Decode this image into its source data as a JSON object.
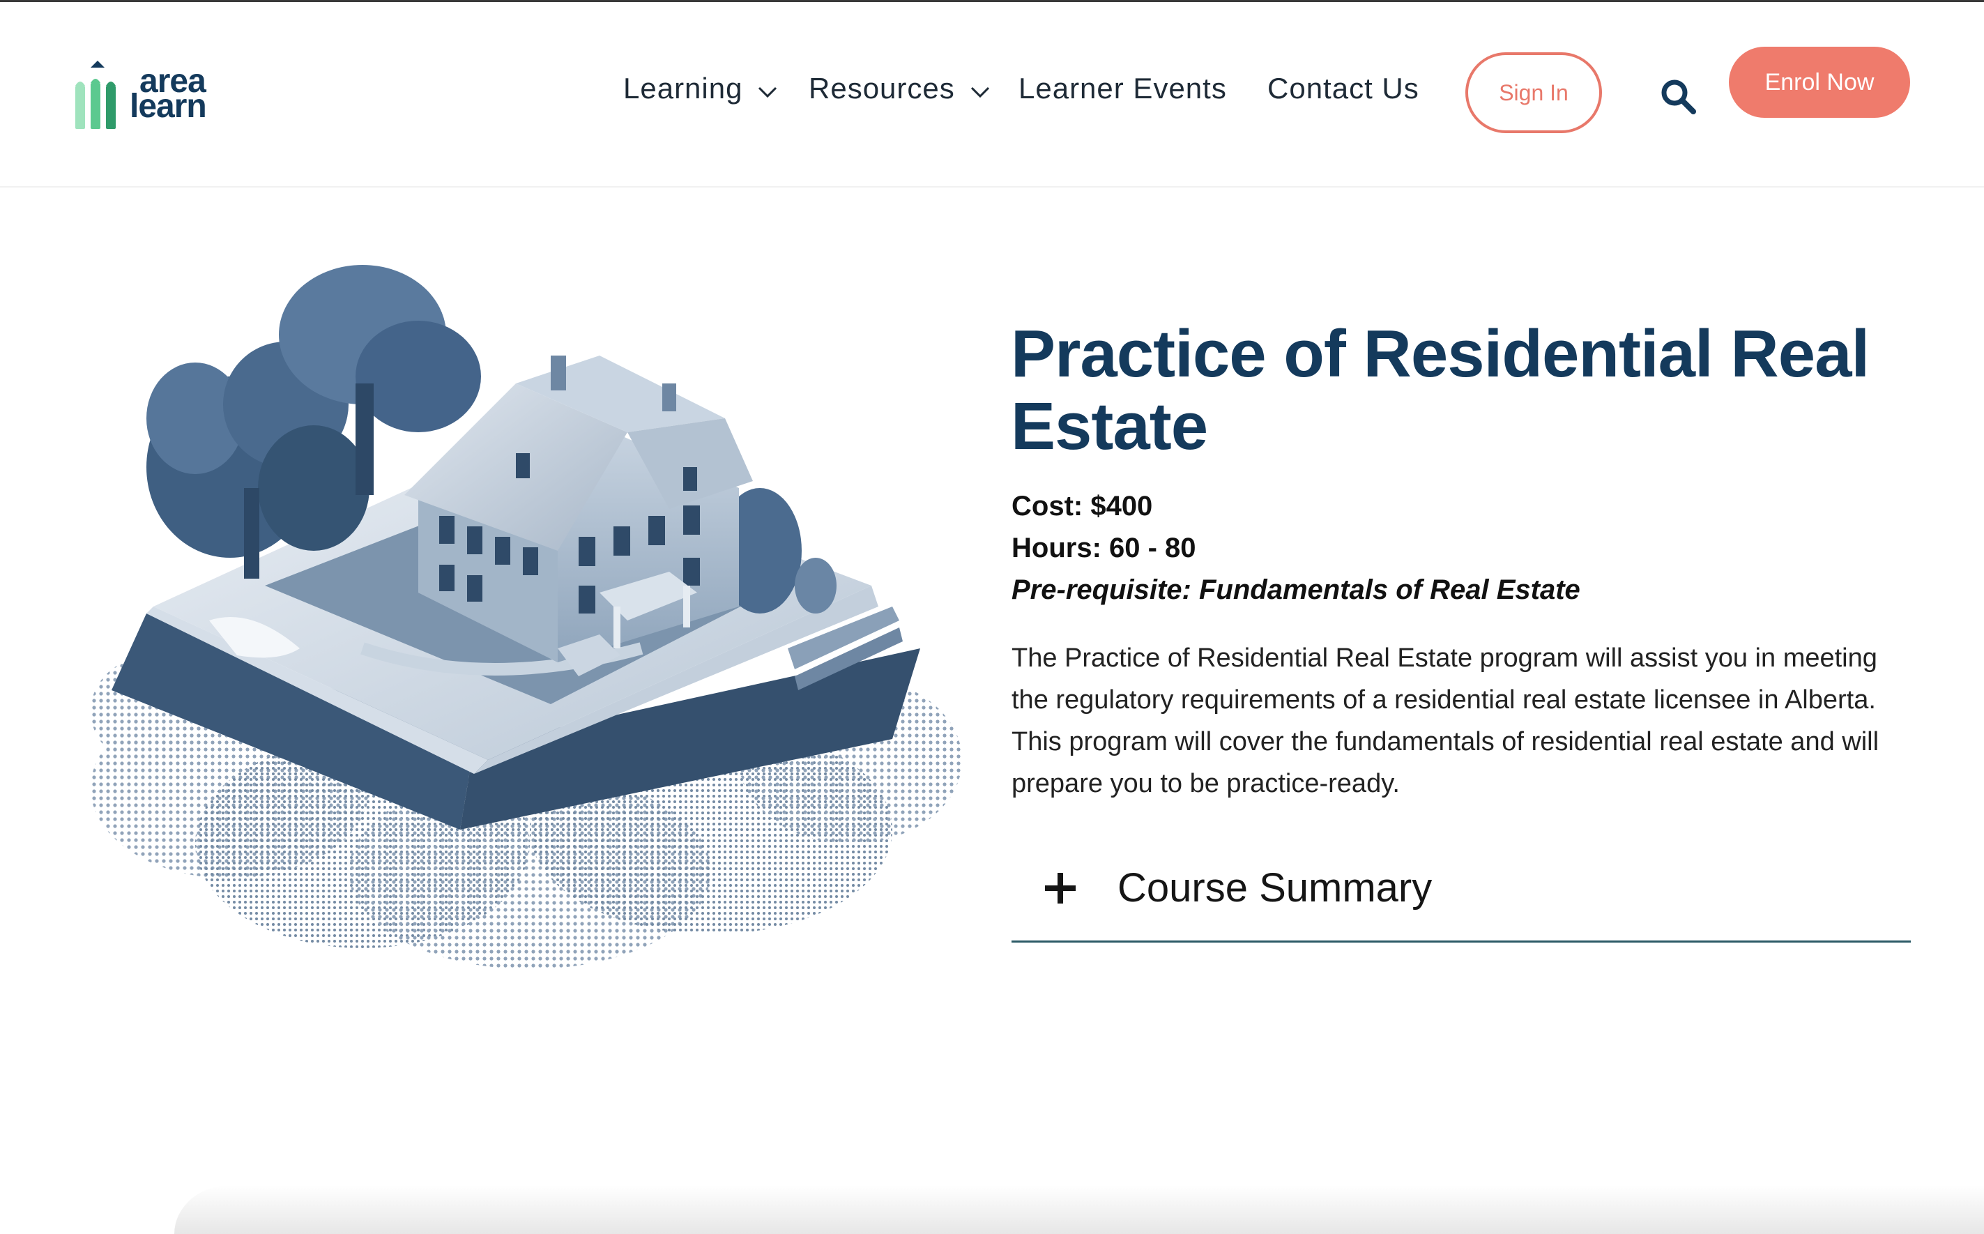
{
  "brand": {
    "logo_line1": "area",
    "logo_line2": "learn",
    "logo_icon": "pencil-bars-logo",
    "colors": {
      "navy": "#143a5c",
      "green": "#6fd3a0",
      "coral": "#ef7b6c"
    }
  },
  "nav": {
    "items": [
      {
        "label": "Learning",
        "has_dropdown": true
      },
      {
        "label": "Resources",
        "has_dropdown": true
      },
      {
        "label": "Learner Events",
        "has_dropdown": false
      },
      {
        "label": "Contact Us",
        "has_dropdown": false
      }
    ],
    "sign_in_label": "Sign In",
    "search_icon": "search-icon",
    "enrol_label": "Enrol Now"
  },
  "course": {
    "title": "Practice of Residential Real Estate",
    "cost": "Cost: $400",
    "hours": "Hours: 60 - 80",
    "prerequisite": "Pre-requisite: Fundamentals of Real Estate",
    "description": "The Practice of Residential Real Estate program will assist you in meeting the regulatory requirements of a residential real estate licensee in Alberta. This program will cover the fundamentals of residential real estate and will prepare you to be practice-ready.",
    "accordion_label": "Course Summary",
    "accordion_icon": "plus-icon"
  },
  "hero_image": {
    "subject": "house-on-open-book-illustration"
  }
}
